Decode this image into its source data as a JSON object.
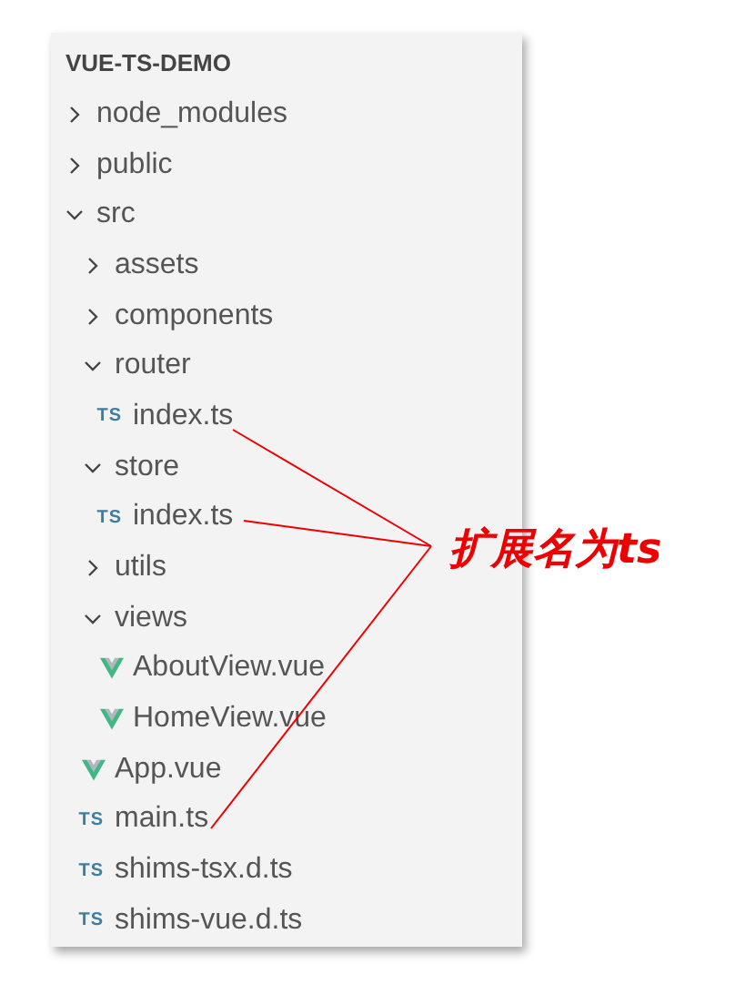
{
  "explorer": {
    "title": "VUE-TS-DEMO",
    "items": [
      {
        "kind": "folder",
        "name": "node_modules",
        "expanded": false
      },
      {
        "kind": "folder",
        "name": "public",
        "expanded": false
      },
      {
        "kind": "folder",
        "name": "src",
        "expanded": true,
        "children": [
          {
            "kind": "folder",
            "name": "assets",
            "expanded": false
          },
          {
            "kind": "folder",
            "name": "components",
            "expanded": false
          },
          {
            "kind": "folder",
            "name": "router",
            "expanded": true,
            "children": [
              {
                "kind": "ts-file",
                "badge": "TS",
                "name": "index.ts"
              }
            ]
          },
          {
            "kind": "folder",
            "name": "store",
            "expanded": true,
            "children": [
              {
                "kind": "ts-file",
                "badge": "TS",
                "name": "index.ts"
              }
            ]
          },
          {
            "kind": "folder",
            "name": "utils",
            "expanded": false
          },
          {
            "kind": "folder",
            "name": "views",
            "expanded": true,
            "children": [
              {
                "kind": "vue-file",
                "name": "AboutView.vue"
              },
              {
                "kind": "vue-file",
                "name": "HomeView.vue"
              }
            ]
          },
          {
            "kind": "vue-file",
            "name": "App.vue"
          },
          {
            "kind": "ts-file",
            "badge": "TS",
            "name": "main.ts"
          },
          {
            "kind": "ts-file",
            "badge": "TS",
            "name": "shims-tsx.d.ts"
          },
          {
            "kind": "ts-file",
            "badge": "TS",
            "name": "shims-vue.d.ts"
          }
        ]
      }
    ]
  },
  "annotation": {
    "text": "扩展名为ts"
  }
}
